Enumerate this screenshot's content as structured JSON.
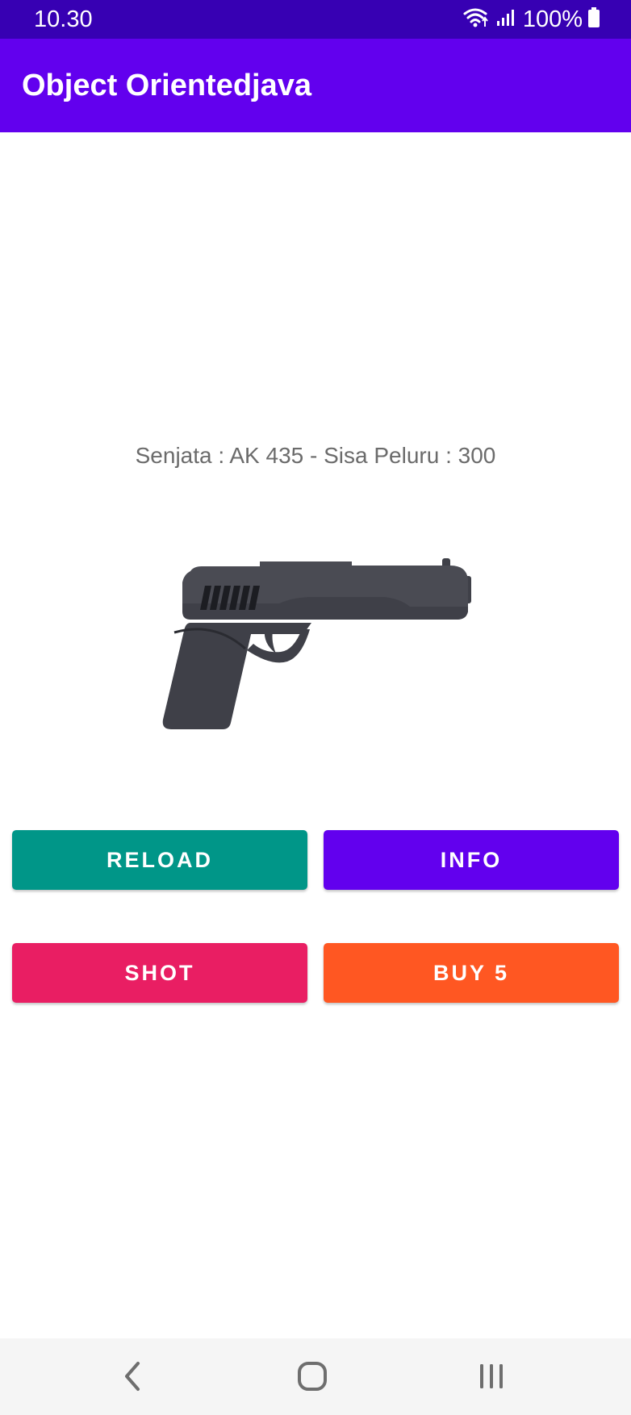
{
  "status_bar": {
    "time": "10.30",
    "battery": "100%",
    "icons": [
      "wifi-icon",
      "signal-icon",
      "battery-icon"
    ]
  },
  "app_bar": {
    "title": "Object Orientedjava"
  },
  "main": {
    "info_text": "Senjata : AK 435 - Sisa Peluru : 300",
    "image": "pistol-image"
  },
  "buttons": {
    "reload": "RELOAD",
    "info": "INFO",
    "shot": "SHOT",
    "buy": "BUY 5"
  },
  "nav_bar": {
    "icons": [
      "back-icon",
      "home-icon",
      "recents-icon"
    ]
  },
  "colors": {
    "status_bar": "#3700b3",
    "app_bar": "#6200ee",
    "reload": "#009688",
    "info": "#6200ee",
    "shot": "#e91e63",
    "buy": "#ff5722"
  }
}
